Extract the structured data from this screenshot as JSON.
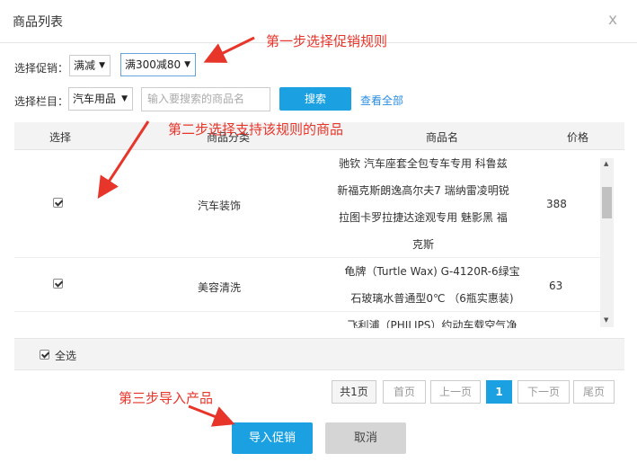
{
  "dialog": {
    "title": "商品列表",
    "close_glyph": "x"
  },
  "filters": {
    "promo_label": "选择促销：",
    "promo_type": "满减",
    "promo_rule": "满300减80",
    "category_label": "选择栏目：",
    "category_value": "汽车用品",
    "search_placeholder": "输入要搜索的商品名",
    "search_button": "搜索",
    "view_all": "查看全部"
  },
  "annotations": {
    "step1": "第一步选择促销规则",
    "step2": "第二步选择支持该规则的商品",
    "step3": "第三步导入产品",
    "color": "#e8352a"
  },
  "table": {
    "headers": [
      "选择",
      "商品分类",
      "商品名",
      "价格"
    ],
    "rows": [
      {
        "checked": true,
        "category": "汽车装饰",
        "name_lines": [
          "驰钦 汽车座套全包专车专用 科鲁兹",
          "新福克斯朗逸高尔夫7 瑞纳雷凌明锐",
          "拉图卡罗拉捷达途观专用 魅影黑 福",
          "克斯"
        ],
        "price": "388"
      },
      {
        "checked": true,
        "category": "美容清洗",
        "name_lines": [
          "龟牌（Turtle Wax) G-4120R-6绿宝",
          "石玻璃水普通型0℃ （6瓶实惠装)"
        ],
        "price": "63"
      },
      {
        "checked": true,
        "category": "",
        "name_lines": [
          "飞利浦（PHILIPS）约动车载空气净"
        ],
        "price": ""
      }
    ]
  },
  "footer": {
    "select_all": "全选",
    "select_all_checked": true
  },
  "pagination": {
    "total": "共1页",
    "first": "首页",
    "prev": "上一页",
    "current": "1",
    "next": "下一页",
    "last": "尾页"
  },
  "actions": {
    "import": "导入促销",
    "cancel": "取消"
  },
  "colors": {
    "accent": "#1ba1e2",
    "link": "#2a8ce0"
  }
}
